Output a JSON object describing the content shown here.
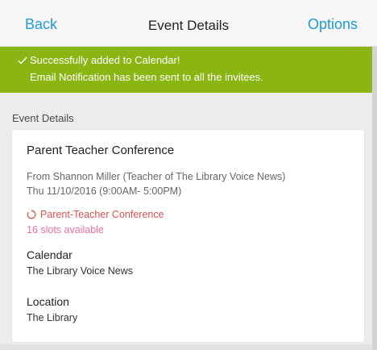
{
  "header": {
    "back_label": "Back",
    "title": "Event Details",
    "options_label": "Options"
  },
  "banner": {
    "line1": "Successfully added to Calendar!",
    "line2": "Email Notification has been sent to all the invitees.",
    "background_color": "#8ab512",
    "icon": "check-icon"
  },
  "section": {
    "label": "Event Details"
  },
  "event": {
    "title": "Parent Teacher Conference",
    "from": "From Shannon Miller (Teacher of The Library Voice News)",
    "datetime": "Thu 11/10/2016 (9:00AM- 5:00PM)",
    "slot_type": "Parent-Teacher Conference",
    "slot_icon": "spinner-icon",
    "slots_available": "16 slots available",
    "calendar_label": "Calendar",
    "calendar_value": "The Library Voice News",
    "location_label": "Location",
    "location_value": "The Library"
  },
  "colors": {
    "link": "#1f9bd1",
    "slot_type": "#d9534f",
    "slots_available": "#ef6fa0"
  }
}
